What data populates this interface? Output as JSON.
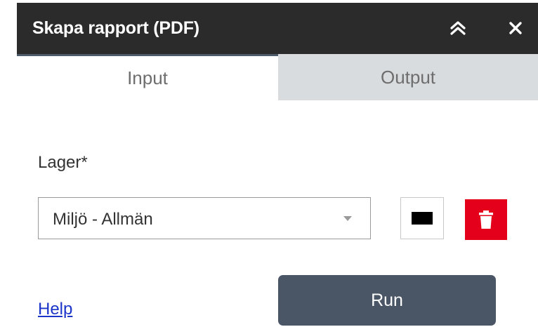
{
  "header": {
    "title": "Skapa rapport (PDF)",
    "collapse_icon": "double-chevron-up-icon",
    "close_icon": "close-icon"
  },
  "tabs": [
    {
      "label": "Input",
      "active": true
    },
    {
      "label": "Output",
      "active": false
    }
  ],
  "form": {
    "layer_label": "Lager*",
    "layer_value": "Miljö - Allmän",
    "color_swatch": "#000000",
    "delete_icon": "trash-icon"
  },
  "footer": {
    "help_label": "Help",
    "run_label": "Run"
  },
  "colors": {
    "header_bg": "#2b2b2b",
    "tab_inactive_bg": "#d8dcdf",
    "delete_bg": "#e4001b",
    "run_bg": "#4a5666",
    "link": "#1c35c9"
  }
}
